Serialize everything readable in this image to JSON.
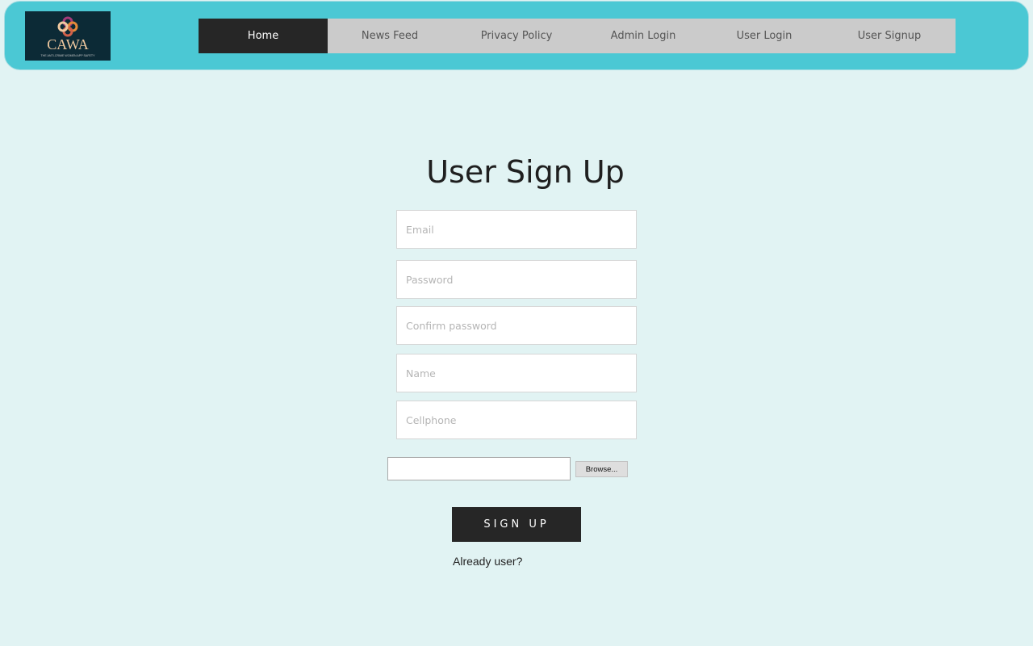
{
  "header": {
    "logo": {
      "text": "CAWA",
      "tagline": "THE ANTI-CRIME WOMEN APP SAFETY",
      "icon": "quatrefoil-logo-icon"
    },
    "nav": [
      {
        "label": "Home",
        "active": true
      },
      {
        "label": "News Feed",
        "active": false
      },
      {
        "label": "Privacy Policy",
        "active": false
      },
      {
        "label": "Admin Login",
        "active": false
      },
      {
        "label": "User Login",
        "active": false
      },
      {
        "label": "User Signup",
        "active": false
      }
    ]
  },
  "form": {
    "title": "User Sign Up",
    "fields": {
      "email": {
        "placeholder": "Email",
        "value": ""
      },
      "password": {
        "placeholder": "Password",
        "value": ""
      },
      "confirm_password": {
        "placeholder": "Confirm password",
        "value": ""
      },
      "name": {
        "placeholder": "Name",
        "value": ""
      },
      "cellphone": {
        "placeholder": "Cellphone",
        "value": ""
      }
    },
    "file": {
      "value": "",
      "browse_label": "Browse..."
    },
    "submit_label": "SIGN UP",
    "already_user_link": "Already user?"
  },
  "colors": {
    "page_background": "#e1f3f3",
    "header_background": "#4bc8d4",
    "nav_background": "#cbcbcb",
    "nav_active": "#262626",
    "button_dark": "#262626",
    "logo_background": "#0c2a36",
    "logo_text": "#f0c9a0",
    "logo_icon_primary": "#a53a7a",
    "logo_icon_secondary": "#e58a3a"
  }
}
